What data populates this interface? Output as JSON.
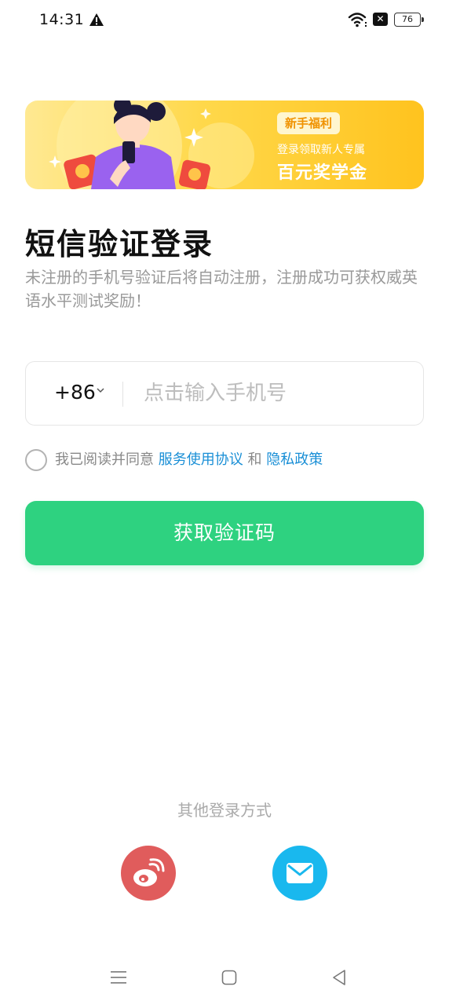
{
  "status_bar": {
    "time": "14:31",
    "battery": "76",
    "icons": [
      "warning-icon",
      "wifi-icon",
      "sim-off-icon",
      "battery-icon"
    ]
  },
  "banner": {
    "badge": "新手福利",
    "line1": "登录领取新人专属",
    "line2": "百元奖学金"
  },
  "login": {
    "title": "短信验证登录",
    "subtitle": "未注册的手机号验证后将自动注册，注册成功可获权威英语水平测试奖励！",
    "country_code": "+86",
    "phone_placeholder": "点击输入手机号",
    "phone_value": "",
    "agree_prefix": "我已阅读并同意",
    "terms_link": "服务使用协议",
    "agree_and": "和",
    "privacy_link": "隐私政策",
    "sms_button": "获取验证码"
  },
  "other_login": {
    "title": "其他登录方式",
    "options": [
      "weibo-icon",
      "email-icon"
    ]
  },
  "nav_bar": {
    "icons": [
      "menu-icon",
      "home-icon",
      "back-icon"
    ]
  },
  "colors": {
    "primary_green": "#2ed280",
    "link_blue": "#1a8fd6",
    "weibo_red": "#e05c5c",
    "email_blue": "#19b8ee",
    "banner_yellow": "#ffd84a"
  }
}
